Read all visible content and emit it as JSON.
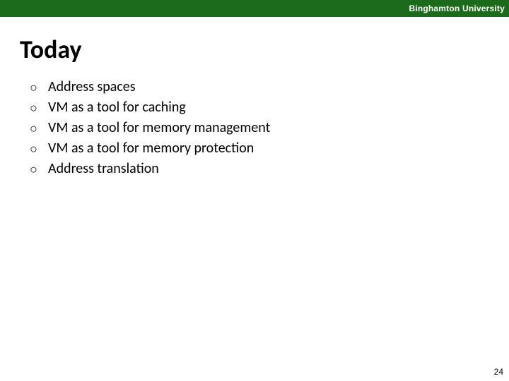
{
  "header": {
    "institution": "Binghamton University"
  },
  "slide": {
    "title": "Today",
    "bullets": [
      "Address spaces",
      "VM as a tool for caching",
      "VM as a tool for memory management",
      "VM as a tool for memory protection",
      "Address translation"
    ],
    "page_number": "24"
  }
}
